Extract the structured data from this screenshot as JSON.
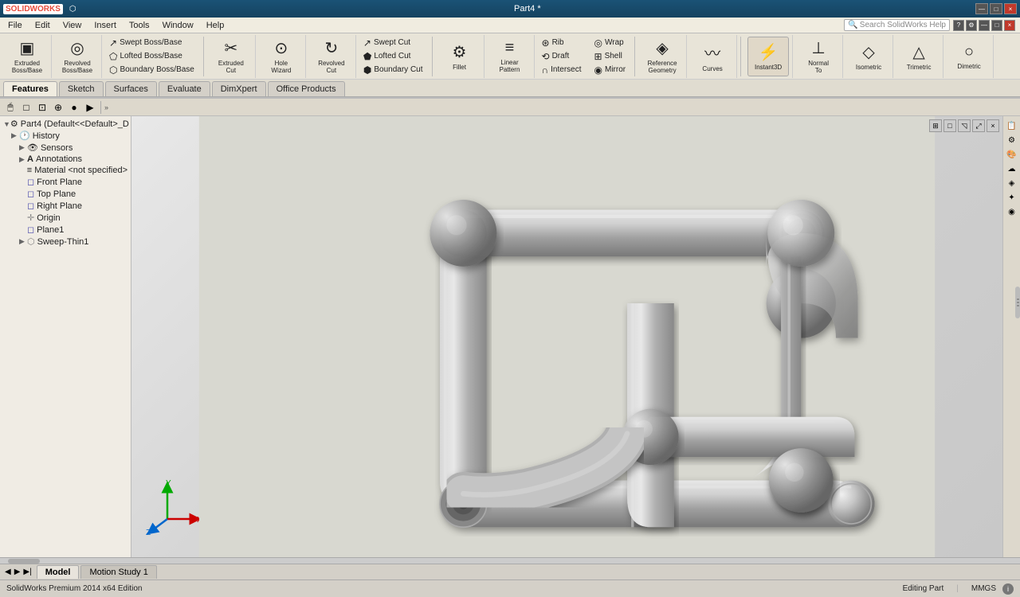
{
  "titlebar": {
    "logo": "SOLIDWORKS",
    "title": "Part4 *",
    "controls": [
      "—",
      "□",
      "×"
    ]
  },
  "menubar": {
    "items": [
      "File",
      "Edit",
      "View",
      "Insert",
      "Tools",
      "Window",
      "Help"
    ]
  },
  "toolbar": {
    "groups": [
      {
        "buttons_large": [
          {
            "icon": "▣",
            "label": "Extruded\nBoss/Base"
          },
          {
            "icon": "◎",
            "label": "Revolved\nBoss/Base"
          }
        ],
        "buttons_small_cols": []
      }
    ],
    "buttons_small": [
      {
        "icon": "↗",
        "label": "Swept Boss/Base"
      },
      {
        "icon": "⬠",
        "label": "Lofted Boss/Base"
      },
      {
        "icon": "⬡",
        "label": "Boundary Boss/Base"
      },
      {
        "icon": "✂",
        "label": "Swept Cut"
      },
      {
        "icon": "⬟",
        "label": "Lofted Cut"
      },
      {
        "icon": "⬢",
        "label": "Boundary Cut"
      },
      {
        "icon": "✦",
        "label": "Extruded Cut"
      },
      {
        "icon": "⊙",
        "label": "Hole Wizard"
      },
      {
        "icon": "↻",
        "label": "Revolved Cut"
      },
      {
        "icon": "⚙",
        "label": "Fillet"
      },
      {
        "icon": "≡",
        "label": "Linear Pattern"
      },
      {
        "icon": "⊛",
        "label": "Rib"
      },
      {
        "icon": "⟲",
        "label": "Draft"
      },
      {
        "icon": "∩",
        "label": "Intersect"
      },
      {
        "icon": "◈",
        "label": "Reference Geometry"
      },
      {
        "icon": "〰",
        "label": "Curves"
      },
      {
        "icon": "⚡",
        "label": "Instant3D"
      },
      {
        "icon": "⊥",
        "label": "Normal To"
      },
      {
        "icon": "◇",
        "label": "Isometric"
      },
      {
        "icon": "△",
        "label": "Trimetric"
      },
      {
        "icon": "○",
        "label": "Dimetric"
      },
      {
        "icon": "◎",
        "label": "Wrap"
      },
      {
        "icon": "⊞",
        "label": "Shell"
      },
      {
        "icon": "◉",
        "label": "Mirror"
      },
      {
        "icon": "≋",
        "label": "Mirror"
      }
    ]
  },
  "tabs": {
    "items": [
      "Features",
      "Sketch",
      "Surfaces",
      "Evaluate",
      "DimXpert",
      "Office Products"
    ],
    "active": "Features"
  },
  "feature_tree": {
    "root": "Part4 (Default<<Default>_D",
    "items": [
      {
        "label": "History",
        "indent": 1,
        "icon": "🕐",
        "expand": "▶"
      },
      {
        "label": "Sensors",
        "indent": 2,
        "icon": "👁",
        "expand": "▶"
      },
      {
        "label": "Annotations",
        "indent": 2,
        "icon": "A",
        "expand": "▶"
      },
      {
        "label": "Material <not specified>",
        "indent": 2,
        "icon": "≡",
        "expand": ""
      },
      {
        "label": "Front Plane",
        "indent": 2,
        "icon": "◻",
        "expand": ""
      },
      {
        "label": "Top Plane",
        "indent": 2,
        "icon": "◻",
        "expand": ""
      },
      {
        "label": "Right Plane",
        "indent": 2,
        "icon": "◻",
        "expand": ""
      },
      {
        "label": "Origin",
        "indent": 2,
        "icon": "✛",
        "expand": ""
      },
      {
        "label": "Plane1",
        "indent": 2,
        "icon": "◻",
        "expand": ""
      },
      {
        "label": "Sweep-Thin1",
        "indent": 2,
        "icon": "⬡",
        "expand": "▶"
      }
    ]
  },
  "viewport": {
    "background_top": "#e0e0e0",
    "background_bottom": "#c0c0c0"
  },
  "view_toolbar": {
    "buttons": [
      "🔍",
      "🔎",
      "◎",
      "▦",
      "⬡",
      "⊕",
      "✦",
      "⊞",
      "◈",
      "⟳"
    ]
  },
  "statusbar": {
    "left": "SolidWorks Premium 2014 x64 Edition",
    "middle": "Editing Part",
    "right_units": "MMGS",
    "right_info": "ℹ"
  },
  "bottom_tabs": {
    "items": [
      "Model",
      "Motion Study 1"
    ],
    "active": "Model"
  },
  "axis": {
    "x_label": "X",
    "y_label": "Y",
    "z_label": "Z"
  }
}
